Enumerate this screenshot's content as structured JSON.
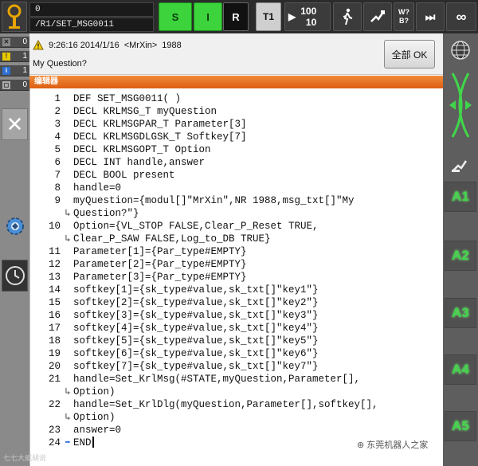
{
  "topbar": {
    "message_count": "0",
    "program_path": "/R1/SET_MSG0011",
    "submit_label": "S",
    "robot_label": "I",
    "run_mode_label": "R",
    "op_mode_label": "T1",
    "override_speed": "100",
    "jog_increment": "10",
    "wb_label_top": "W?",
    "wb_label_bottom": "B?",
    "infinity_label": "∞"
  },
  "counters": [
    {
      "value": "0",
      "icon": "close-x-icon"
    },
    {
      "value": "1",
      "icon": "warning-icon"
    },
    {
      "value": "1",
      "icon": "info-icon"
    },
    {
      "value": "0",
      "icon": "ok-icon"
    }
  ],
  "message": {
    "time": "9:26:16 2014/1/16",
    "sender": "<MrXin>",
    "number": "1988",
    "text": "My Question?",
    "ack_all_label": "全部 OK"
  },
  "editor": {
    "header": "编辑器",
    "lines": [
      {
        "n": "1",
        "code": "DEF SET_MSG0011( )"
      },
      {
        "n": "2",
        "code": "DECL KRLMSG_T myQuestion"
      },
      {
        "n": "3",
        "code": "DECL KRLMSGPAR_T Parameter[3]"
      },
      {
        "n": "4",
        "code": "DECL KRLMSGDLGSK_T Softkey[7]"
      },
      {
        "n": "5",
        "code": "DECL KRLMSGOPT_T Option"
      },
      {
        "n": "6",
        "code": "DECL INT handle,answer"
      },
      {
        "n": "7",
        "code": "DECL BOOL present"
      },
      {
        "n": "8",
        "code": "handle=0"
      },
      {
        "n": "9",
        "code": "myQuestion={modul[]\"MrXin\",NR 1988,msg_txt[]\"My"
      },
      {
        "n": "",
        "code": "Question?\"}",
        "wrap": true
      },
      {
        "n": "10",
        "code": "Option={VL_STOP FALSE,Clear_P_Reset TRUE,"
      },
      {
        "n": "",
        "code": "Clear_P_SAW FALSE,Log_to_DB TRUE}",
        "wrap": true
      },
      {
        "n": "11",
        "code": "Parameter[1]={Par_type#EMPTY}"
      },
      {
        "n": "12",
        "code": "Parameter[2]={Par_type#EMPTY}"
      },
      {
        "n": "13",
        "code": "Parameter[3]={Par_type#EMPTY}"
      },
      {
        "n": "14",
        "code": "softkey[1]={sk_type#value,sk_txt[]\"key1\"}"
      },
      {
        "n": "15",
        "code": "softkey[2]={sk_type#value,sk_txt[]\"key2\"}"
      },
      {
        "n": "16",
        "code": "softkey[3]={sk_type#value,sk_txt[]\"key3\"}"
      },
      {
        "n": "17",
        "code": "softkey[4]={sk_type#value,sk_txt[]\"key4\"}"
      },
      {
        "n": "18",
        "code": "softkey[5]={sk_type#value,sk_txt[]\"key5\"}"
      },
      {
        "n": "19",
        "code": "softkey[6]={sk_type#value,sk_txt[]\"key6\"}"
      },
      {
        "n": "20",
        "code": "softkey[7]={sk_type#value,sk_txt[]\"key7\"}"
      },
      {
        "n": "21",
        "code": "handle=Set_KrlMsg(#STATE,myQuestion,Parameter[],"
      },
      {
        "n": "",
        "code": "Option)",
        "wrap": true
      },
      {
        "n": "22",
        "code": "handle=Set_KrlDlg(myQuestion,Parameter[],softkey[],"
      },
      {
        "n": "",
        "code": "Option)",
        "wrap": true
      },
      {
        "n": "23",
        "code": "answer=0"
      },
      {
        "n": "24",
        "code": "END",
        "current": true
      }
    ]
  },
  "right_keys": [
    "A1",
    "A2",
    "A3",
    "A4",
    "A5"
  ],
  "watermarks": {
    "bottom_left": "七七大威胡说",
    "bottom_right": "东莞机器人之家"
  },
  "colors": {
    "green_active": "#3cd33c",
    "editor_header": "#de5e12",
    "axis_key_text": "#41d64a"
  }
}
